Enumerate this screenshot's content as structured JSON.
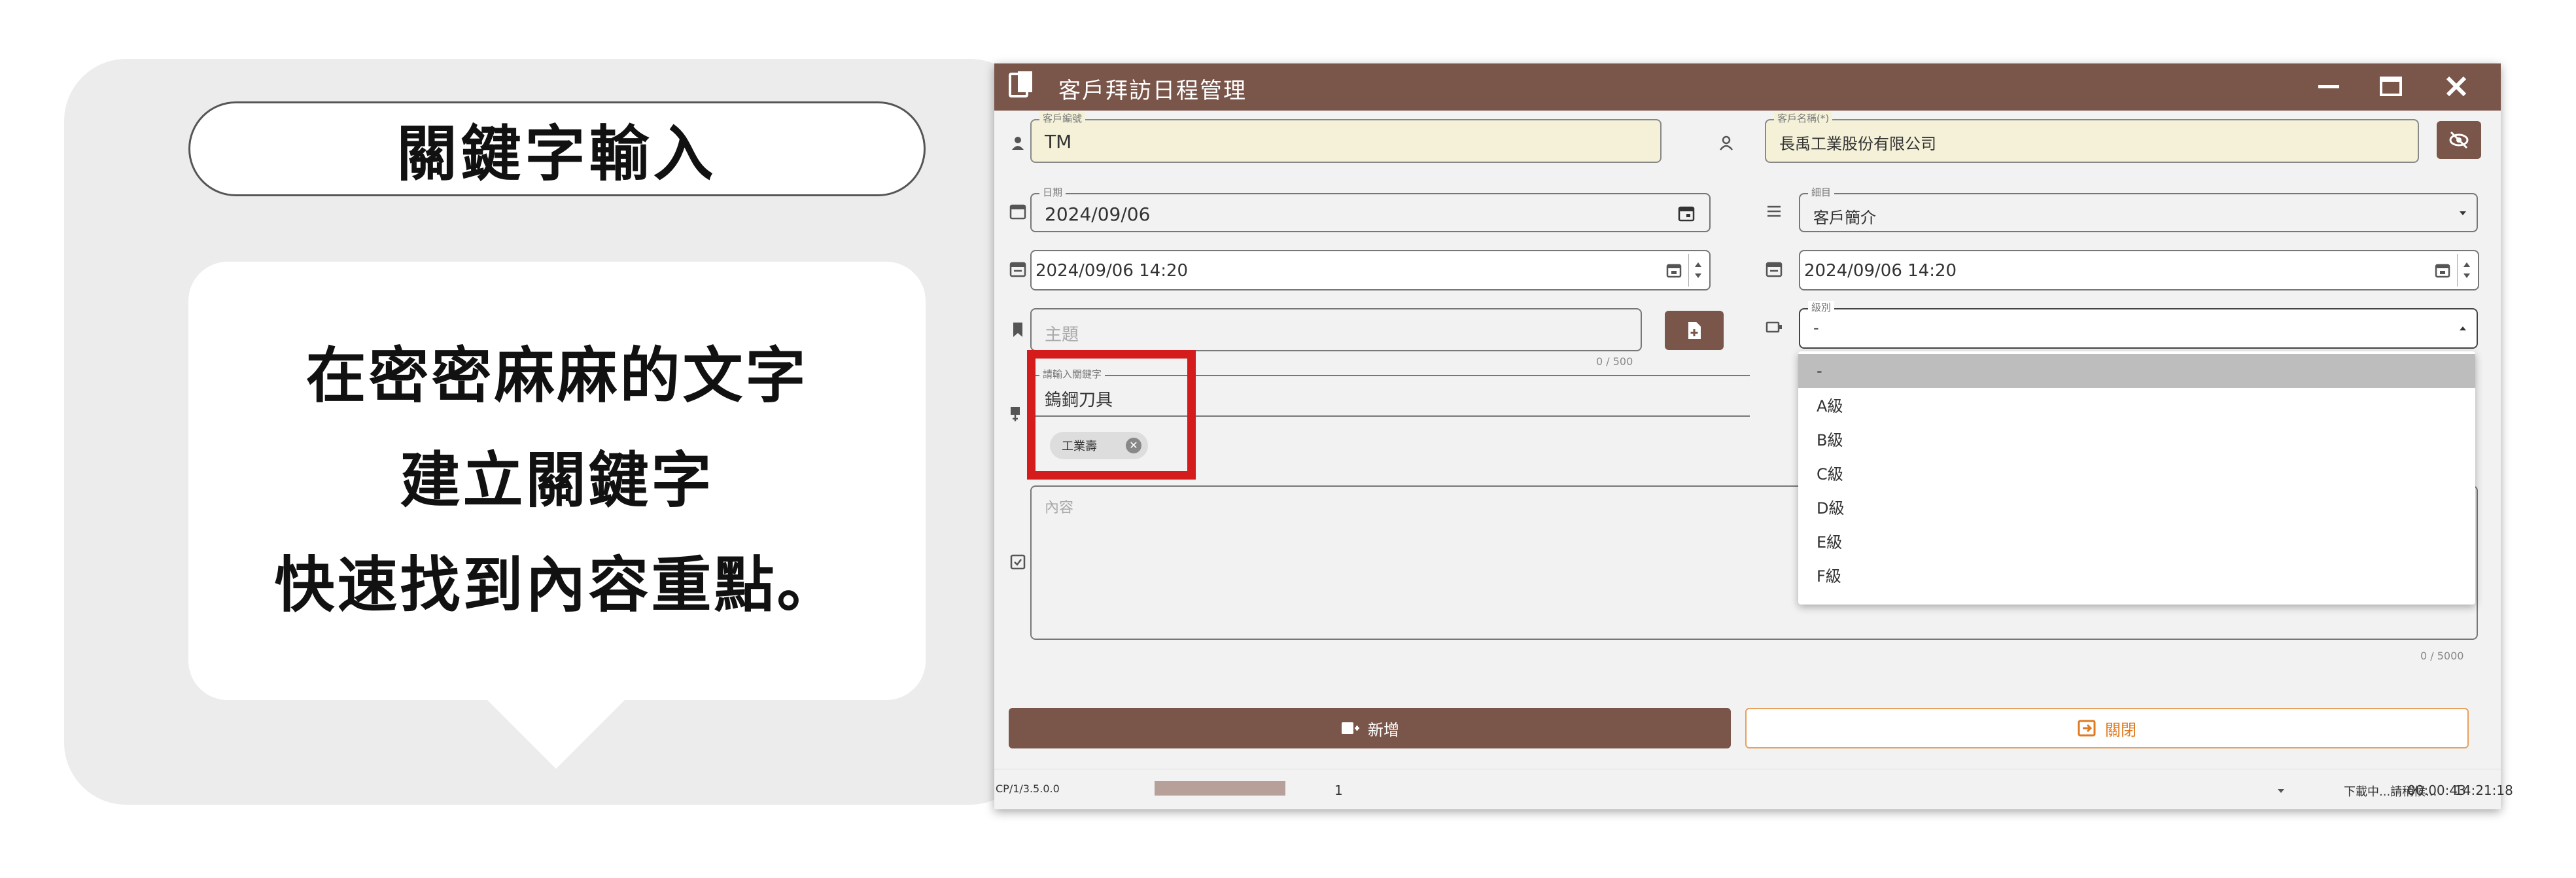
{
  "promo": {
    "title": "關鍵字輸入",
    "lines": [
      "在密密麻麻的文字",
      "建立關鍵字",
      "快速找到內容重點。"
    ]
  },
  "window": {
    "title": "客戶拜訪日程管理",
    "titlebar_color": "#7a5549"
  },
  "form": {
    "customer_code": {
      "label": "客戶編號",
      "value": "TM"
    },
    "customer_name": {
      "label": "客戶名稱(*)",
      "value": "長禹工業股份有限公司"
    },
    "date": {
      "label": "日期",
      "value": "2024/09/06"
    },
    "category": {
      "label": "細目",
      "value": "客戶簡介"
    },
    "start_datetime": {
      "value": "2024/09/06 14:20"
    },
    "end_datetime": {
      "value": "2024/09/06 14:20"
    },
    "subject": {
      "placeholder": "主題",
      "counter": "0 / 500"
    },
    "level": {
      "label": "級別",
      "value": "-"
    },
    "keyword": {
      "label": "請輸入關鍵字",
      "value": "鎢鋼刀具",
      "chip": "工業壽"
    },
    "content": {
      "placeholder": "內容",
      "counter": "0 / 5000"
    }
  },
  "dropdown": {
    "options": [
      "-",
      "A級",
      "B級",
      "C級",
      "D級",
      "E級",
      "F級"
    ],
    "selected": "-"
  },
  "buttons": {
    "add": "新增",
    "close": "關閉"
  },
  "statusbar": {
    "version": "CP/1/3.5.0.0",
    "page": "1",
    "status": "下載中...請稍候...",
    "elapsed": "00:00:43",
    "clock": "14:21:18"
  },
  "colors": {
    "accent": "#7a5549",
    "highlight": "#d41c1c",
    "close_outline": "#e8a05a"
  }
}
